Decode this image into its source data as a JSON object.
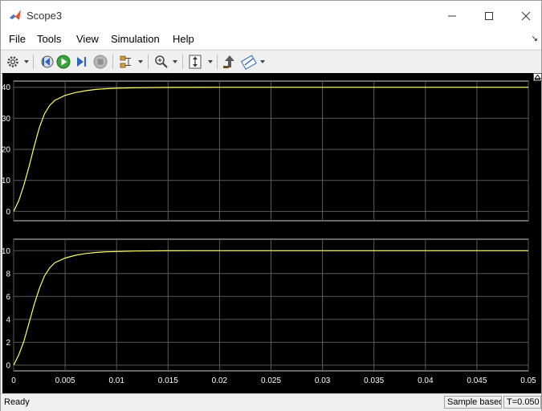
{
  "window": {
    "title": "Scope3"
  },
  "menu": {
    "items": [
      "File",
      "Tools",
      "View",
      "Simulation",
      "Help"
    ]
  },
  "toolbar": {
    "icons": [
      "gear-icon",
      "step-back-icon",
      "run-icon",
      "step-forward-icon",
      "stop-icon",
      "layout-icon",
      "zoom-icon",
      "scale-axes-icon",
      "highlight-block-icon",
      "triggers-icon"
    ]
  },
  "colors": {
    "trace": "#ffff66",
    "background": "#000000",
    "grid": "#5a5a5a"
  },
  "chart_data": [
    {
      "type": "line",
      "title": "",
      "xlabel": "",
      "ylabel": "",
      "xlim": [
        0,
        0.05
      ],
      "ylim": [
        -3,
        42
      ],
      "yticks": [
        0,
        10,
        20,
        30,
        40
      ],
      "ytick_labels": [
        "0",
        "10",
        "20",
        "30",
        "40"
      ],
      "grid": true,
      "series": [
        {
          "x": [
            0,
            0.0005,
            0.001,
            0.0015,
            0.002,
            0.0025,
            0.003,
            0.0035,
            0.004,
            0.005,
            0.006,
            0.007,
            0.008,
            0.009,
            0.01,
            0.012,
            0.015,
            0.02,
            0.05
          ],
          "values": [
            0,
            3.5,
            8.5,
            14.5,
            21,
            27,
            31.5,
            34.2,
            35.8,
            37.4,
            38.3,
            38.9,
            39.3,
            39.55,
            39.7,
            39.85,
            39.95,
            40,
            40
          ]
        }
      ]
    },
    {
      "type": "line",
      "title": "",
      "xlabel": "",
      "ylabel": "",
      "xlim": [
        0,
        0.05
      ],
      "ylim": [
        -0.5,
        11
      ],
      "yticks": [
        0,
        2,
        4,
        6,
        8,
        10
      ],
      "ytick_labels": [
        "0",
        "2",
        "4",
        "6",
        "8",
        "10"
      ],
      "xticks": [
        0,
        0.005,
        0.01,
        0.015,
        0.02,
        0.025,
        0.03,
        0.035,
        0.04,
        0.045,
        0.05
      ],
      "xtick_labels": [
        "0",
        "0.005",
        "0.01",
        "0.015",
        "0.02",
        "0.025",
        "0.03",
        "0.035",
        "0.04",
        "0.045",
        "0.05"
      ],
      "grid": true,
      "series": [
        {
          "x": [
            0,
            0.0005,
            0.001,
            0.0015,
            0.002,
            0.0025,
            0.003,
            0.0035,
            0.004,
            0.005,
            0.006,
            0.007,
            0.008,
            0.009,
            0.01,
            0.012,
            0.015,
            0.017,
            0.05
          ],
          "values": [
            0,
            0.9,
            2.1,
            3.7,
            5.3,
            6.7,
            7.8,
            8.5,
            8.95,
            9.35,
            9.6,
            9.75,
            9.84,
            9.9,
            9.93,
            9.97,
            9.99,
            10,
            10
          ]
        }
      ]
    }
  ],
  "status": {
    "text": "Ready",
    "sample_label": "Sample based",
    "time_label": "T=0.050"
  }
}
